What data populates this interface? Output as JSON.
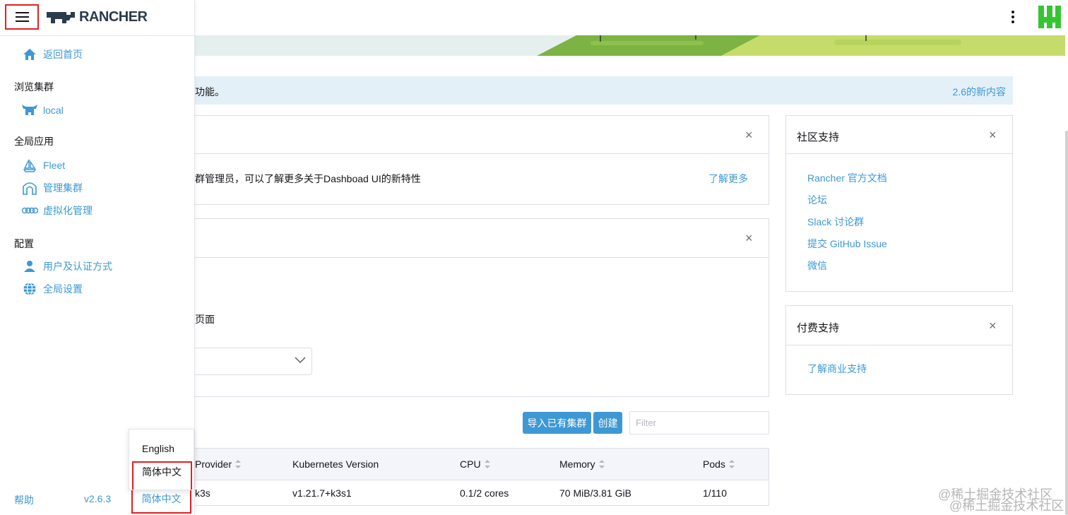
{
  "app": {
    "logo_text": "RANCHER"
  },
  "sidebar": {
    "home": "返回首页",
    "group_clusters": "浏览集群",
    "cluster_local": "local",
    "group_global_apps": "全局应用",
    "apps": [
      "Fleet",
      "管理集群",
      "虚拟化管理"
    ],
    "group_config": "配置",
    "config_items": [
      "用户及认证方式",
      "全局设置"
    ],
    "help": "帮助",
    "version": "v2.6.3",
    "current_language": "简体中文"
  },
  "language_menu": {
    "options": [
      "English",
      "简体中文"
    ]
  },
  "info_strip": {
    "text": "功能。",
    "link": "2.6的新内容"
  },
  "dashboard_panel": {
    "text": "群管理员，可以了解更多关于Dashboad UI的新特性",
    "link": "了解更多"
  },
  "landing_panel": {
    "text": "页面"
  },
  "community": {
    "title": "社区支持",
    "links": [
      "Rancher 官方文档",
      "论坛",
      "Slack 讨论群",
      "提交 GitHub Issue",
      "微信"
    ]
  },
  "paid": {
    "title": "付费支持",
    "link": "了解商业支持"
  },
  "clusters": {
    "import_button": "导入已有集群",
    "create_button": "创建",
    "filter_placeholder": "Filter",
    "columns": [
      "Provider",
      "Kubernetes Version",
      "CPU",
      "Memory",
      "Pods"
    ],
    "rows": [
      {
        "provider": "k3s",
        "version": "v1.21.7+k3s1",
        "cpu": "0.1/2 cores",
        "memory": "70 MiB/3.81 GiB",
        "pods": "1/110"
      }
    ]
  },
  "close_symbol": "×",
  "watermark": "@稀土掘金技术社区",
  "colors": {
    "link": "#3d98d3",
    "highlight_box": "#e02020",
    "button": "#3d98d3",
    "avatar": "#36c532"
  },
  "icons": [
    "menu-icon",
    "home-icon",
    "cow-icon",
    "sailboat-icon",
    "cluster-management-icon",
    "virtualization-icon",
    "user-icon",
    "globe-icon",
    "kebab-menu-icon",
    "chevron-down-icon",
    "close-icon"
  ]
}
